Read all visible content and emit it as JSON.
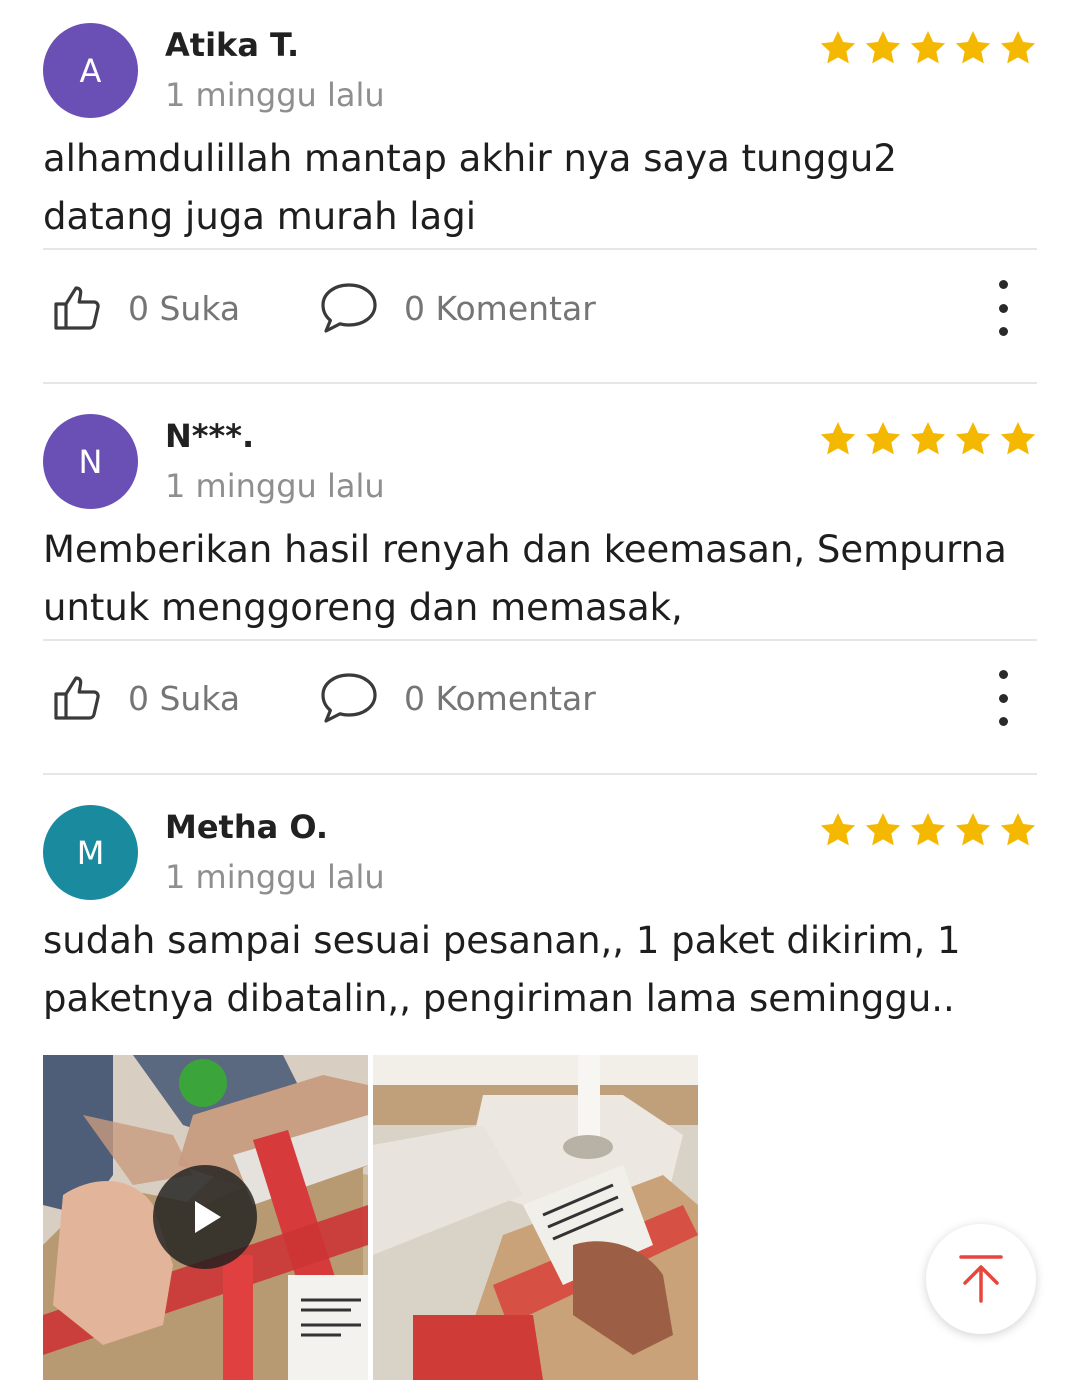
{
  "reviews": [
    {
      "avatar_letter": "A",
      "avatar_color": "#6a4fb5",
      "name": "Atika T.",
      "time": "1 minggu lalu",
      "rating": 5,
      "text": "alhamdulillah mantap akhir nya saya tunggu2 datang juga murah lagi",
      "likes_label": "0 Suka",
      "comments_label": "0 Komentar"
    },
    {
      "avatar_letter": "N",
      "avatar_color": "#6a4fb5",
      "name": "N***.",
      "time": "1 minggu lalu",
      "rating": 5,
      "text": "Memberikan hasil renyah dan keemasan, Sempurna untuk menggoreng dan memasak,",
      "likes_label": "0 Suka",
      "comments_label": "0 Komentar"
    },
    {
      "avatar_letter": "M",
      "avatar_color": "#1a8a9e",
      "name": "Metha O.",
      "time": "1 minggu lalu",
      "rating": 5,
      "text": "sudah sampai sesuai pesanan,, 1 paket dikirim, 1 paketnya dibatalin,, pengiriman lama seminggu..",
      "media": [
        {
          "kind": "video",
          "icon": "play-icon"
        },
        {
          "kind": "photo"
        }
      ]
    }
  ],
  "icons": {
    "like": "thumbs-up-icon",
    "comment": "comment-bubble-icon",
    "more": "more-vertical-icon",
    "star": "star-icon",
    "scroll_top": "arrow-up-to-top-icon"
  },
  "colors": {
    "star": "#f5b800",
    "accent": "#e8453c"
  }
}
